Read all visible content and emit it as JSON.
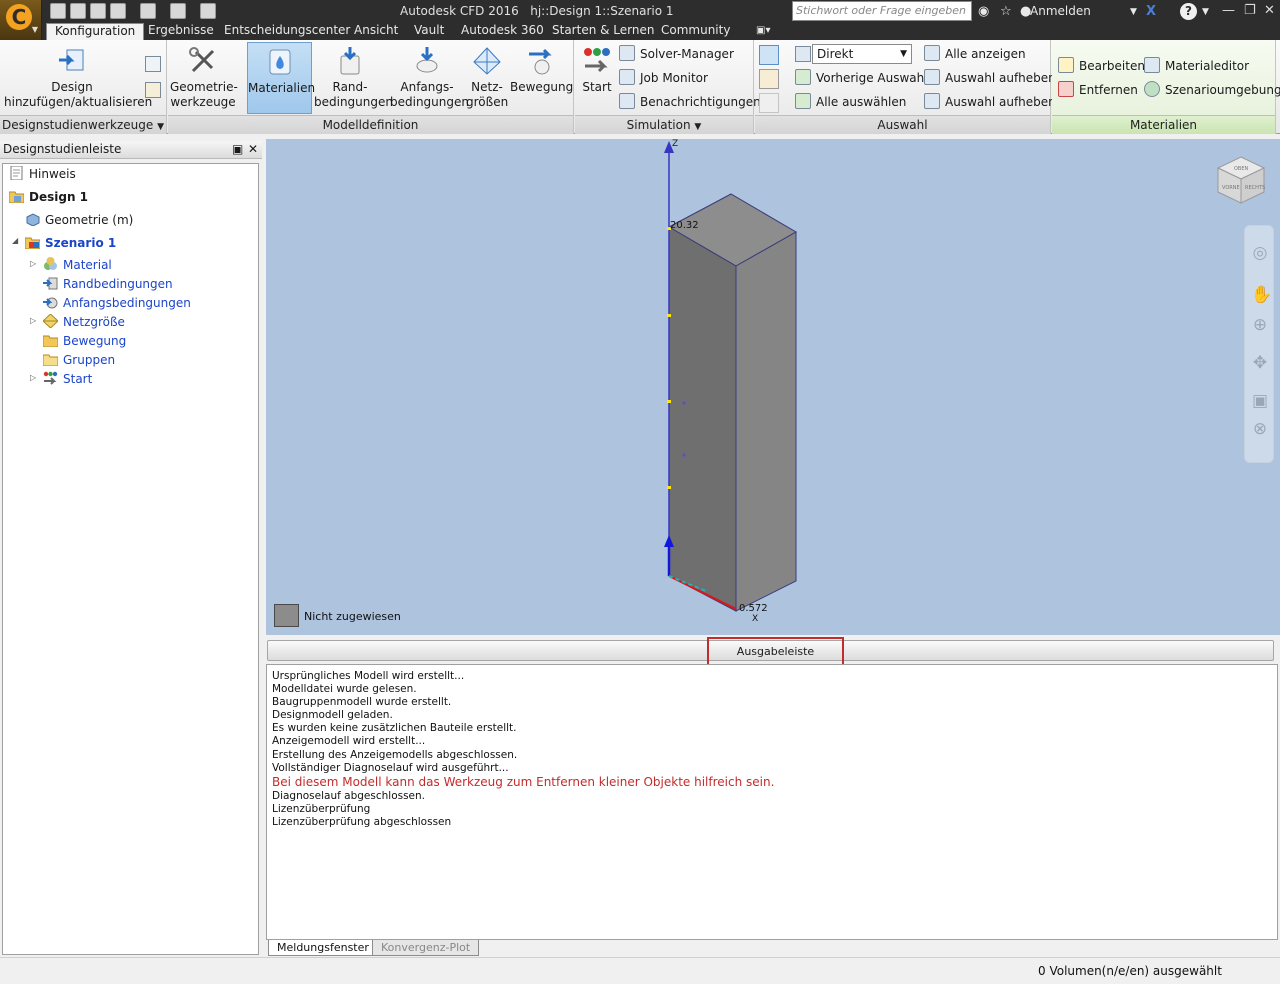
{
  "titlebar": {
    "app_title": "Autodesk CFD 2016",
    "document_title": "hj::Design 1::Szenario 1",
    "search_placeholder": "Stichwort oder Frage eingeben",
    "signin_label": "Anmelden",
    "app_logo_letter": "C"
  },
  "tabs": [
    {
      "label": "Konfiguration",
      "active": true
    },
    {
      "label": "Ergebnisse"
    },
    {
      "label": "Entscheidungscenter"
    },
    {
      "label": "Ansicht"
    },
    {
      "label": "Vault"
    },
    {
      "label": "Autodesk 360"
    },
    {
      "label": "Starten & Lernen"
    },
    {
      "label": "Community"
    }
  ],
  "ribbon": {
    "designstudie": {
      "title": "Designstudienwerkzeuge",
      "add_design": "Design",
      "add_design_2": "hinzufügen/aktualisieren"
    },
    "modelldefinition": {
      "title": "Modelldefinition",
      "geometry": "Geometrie-",
      "geometry_2": "werkzeuge",
      "materials": "Materialien",
      "boundary": "Rand-",
      "boundary_2": "bedingungen",
      "initial": "Anfangs-",
      "initial_2": "bedingungen",
      "mesh": "Netz-",
      "mesh_2": "größen",
      "motion": "Bewegung"
    },
    "simulation": {
      "title": "Simulation",
      "start": "Start",
      "solver_manager": "Solver-Manager",
      "job_monitor": "Job Monitor",
      "notifications": "Benachrichtigungen"
    },
    "auswahl": {
      "title": "Auswahl",
      "mode": "Direkt",
      "previous": "Vorherige Auswahl",
      "select_all": "Alle auswählen",
      "show_all": "Alle anzeigen",
      "clear_1": "Auswahl aufheben",
      "clear_2": "Auswahl aufheben"
    },
    "materialien": {
      "title": "Materialien",
      "edit": "Bearbeiten",
      "remove": "Entfernen",
      "material_editor": "Materialeditor",
      "scenario_env": "Szenarioumgebung"
    }
  },
  "sidebar": {
    "title": "Designstudienleiste",
    "tree": [
      {
        "label": "Hinweis"
      },
      {
        "label": "Design 1"
      },
      {
        "label": "Geometrie (m)"
      },
      {
        "label": "Szenario 1"
      },
      {
        "label": "Material"
      },
      {
        "label": "Randbedingungen"
      },
      {
        "label": "Anfangsbedingungen"
      },
      {
        "label": "Netzgröße"
      },
      {
        "label": "Bewegung"
      },
      {
        "label": "Gruppen"
      },
      {
        "label": "Start"
      }
    ]
  },
  "viewport": {
    "z_axis_label": "Z",
    "x_axis_label": "X",
    "top_value": "20.32",
    "bottom_value": "0.572",
    "legend_label": "Nicht zugewiesen",
    "viewcube_labels": [
      "OBEN",
      "VORNE",
      "RECHTS"
    ]
  },
  "output": {
    "bar_label": "Ausgabeleiste",
    "lines": [
      "Ursprüngliches Modell wird erstellt...",
      "Modelldatei wurde gelesen.",
      "Baugruppenmodell wurde erstellt.",
      "Designmodell geladen.",
      "Es wurden keine zusätzlichen Bauteile erstellt.",
      "Anzeigemodell wird erstellt...",
      "Erstellung des Anzeigemodells abgeschlossen.",
      "Vollständiger Diagnoselauf wird ausgeführt...",
      "Bei diesem Modell kann das Werkzeug zum Entfernen kleiner Objekte hilfreich sein.",
      "Diagnoselauf abgeschlossen.",
      "Lizenzüberprüfung",
      "Lizenzüberprüfung abgeschlossen"
    ],
    "warning_color": "#c42b2b",
    "tabs": [
      {
        "label": "Meldungsfenster",
        "active": true
      },
      {
        "label": "Konvergenz-Plot"
      }
    ]
  },
  "status": {
    "text": "0 Volumen(n/e/en) ausgewählt"
  },
  "colors": {
    "accent": "#1b45c8",
    "viewport_bg": "#aec3de",
    "titlebar_bg": "#2d2d2d"
  }
}
